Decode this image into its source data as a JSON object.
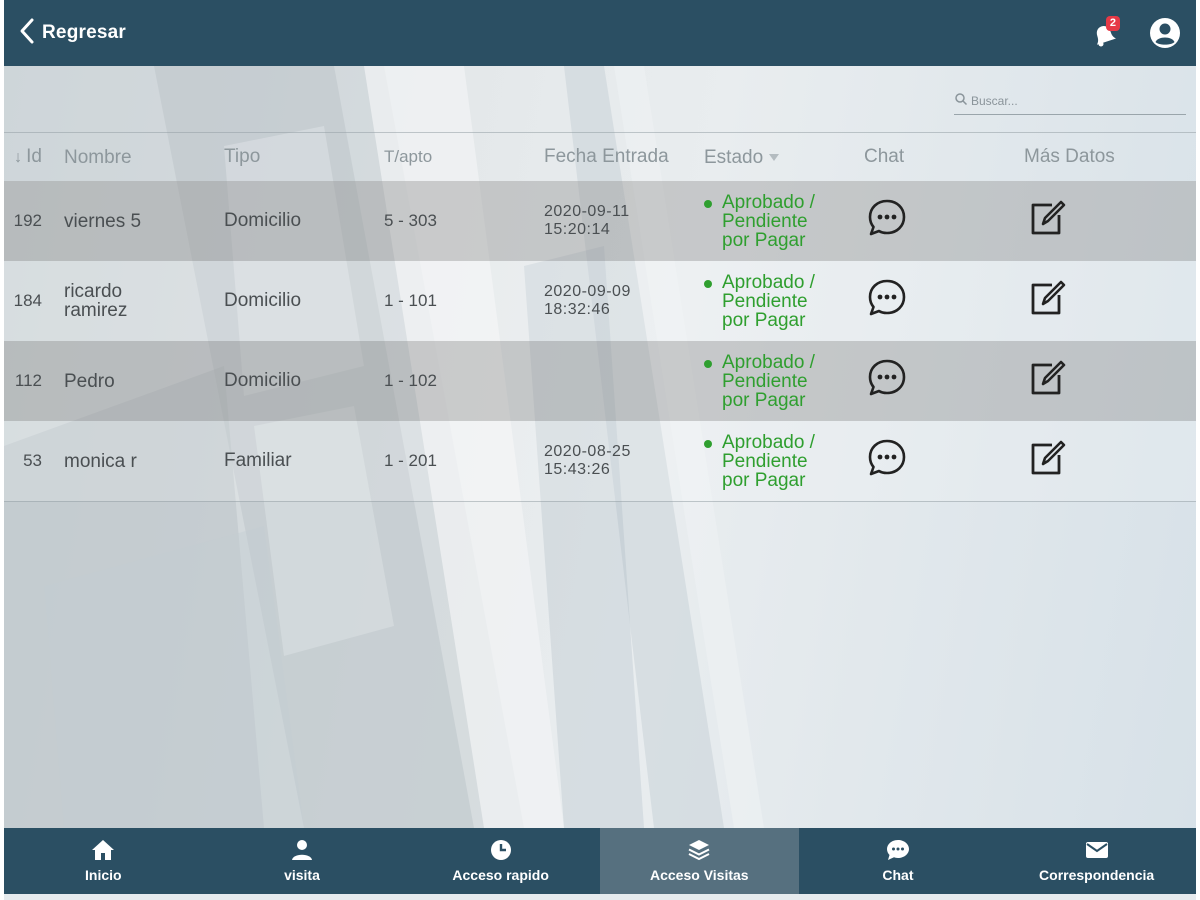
{
  "header": {
    "back_label": "Regresar",
    "notification_count": "2",
    "icons": {
      "back": "chevron-left-icon",
      "notifications": "notification-bell-icon",
      "account": "account-circle-icon"
    }
  },
  "search": {
    "placeholder": "Buscar..."
  },
  "table": {
    "columns": {
      "id": "Id",
      "nombre": "Nombre",
      "tipo": "Tipo",
      "apto": "T/apto",
      "fecha": "Fecha Entrada",
      "estado": "Estado",
      "chat": "Chat",
      "mas": "Más Datos"
    },
    "sort": {
      "column": "id",
      "direction": "descending"
    },
    "rows": [
      {
        "id": "192",
        "nombre_1": "viernes 5",
        "nombre_2": "",
        "tipo": "Domicilio",
        "apto": "5 - 303",
        "fecha_1": "2020-09-11",
        "fecha_2": "15:20:14",
        "estado_1": "Aprobado /",
        "estado_2": "Pendiente",
        "estado_3": "por Pagar"
      },
      {
        "id": "184",
        "nombre_1": "ricardo",
        "nombre_2": "ramirez",
        "tipo": "Domicilio",
        "apto": "1 - 101",
        "fecha_1": "2020-09-09",
        "fecha_2": "18:32:46",
        "estado_1": "Aprobado /",
        "estado_2": "Pendiente",
        "estado_3": "por Pagar"
      },
      {
        "id": "112",
        "nombre_1": "Pedro",
        "nombre_2": "",
        "tipo": "Domicilio",
        "apto": "1 - 102",
        "fecha_1": "",
        "fecha_2": "",
        "estado_1": "Aprobado /",
        "estado_2": "Pendiente",
        "estado_3": "por Pagar"
      },
      {
        "id": "53",
        "nombre_1": "monica r",
        "nombre_2": "",
        "tipo": "Familiar",
        "apto": "1 - 201",
        "fecha_1": "2020-08-25",
        "fecha_2": "15:43:26",
        "estado_1": "Aprobado /",
        "estado_2": "Pendiente",
        "estado_3": "por Pagar"
      }
    ]
  },
  "nav": {
    "items": [
      {
        "label": "Inicio",
        "icon": "home-icon",
        "active": false
      },
      {
        "label": "visita",
        "icon": "person-icon",
        "active": false
      },
      {
        "label": "Acceso rapido",
        "icon": "clock-icon",
        "active": false
      },
      {
        "label": "Acceso Visitas",
        "icon": "layers-icon",
        "active": true
      },
      {
        "label": "Chat",
        "icon": "chat-icon",
        "active": false
      },
      {
        "label": "Correspondencia",
        "icon": "mail-icon",
        "active": false
      }
    ]
  },
  "colors": {
    "header_bg": "#2b4f63",
    "nav_active_bg": "#56707f",
    "status_green": "#2f9f2f",
    "badge_red": "#e63946"
  }
}
